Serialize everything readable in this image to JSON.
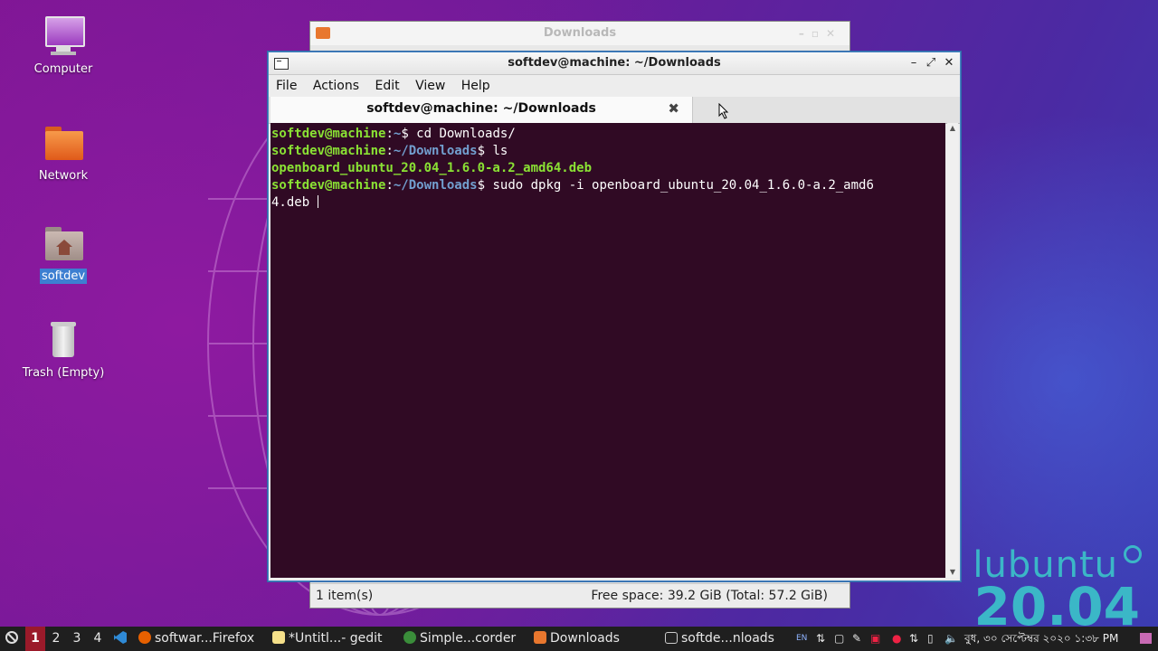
{
  "desktop": {
    "icons": [
      {
        "label": "Computer"
      },
      {
        "label": "Network"
      },
      {
        "label": "softdev"
      },
      {
        "label": "Trash (Empty)"
      }
    ]
  },
  "file_manager": {
    "title": "Downloads",
    "status_items": "1 item(s)",
    "status_free": "Free space: 39.2 GiB (Total: 57.2 GiB)"
  },
  "terminal": {
    "window_title": "softdev@machine: ~/Downloads",
    "menu": [
      "File",
      "Actions",
      "Edit",
      "View",
      "Help"
    ],
    "tab_title": "softdev@machine: ~/Downloads",
    "lines": [
      {
        "user": "softdev@machine",
        "path": "~",
        "prompt": "$",
        "cmd": " cd Downloads/"
      },
      {
        "user": "softdev@machine",
        "path": "~/Downloads",
        "prompt": "$",
        "cmd": " ls"
      },
      {
        "output": "openboard_ubuntu_20.04_1.6.0-a.2_amd64.deb"
      },
      {
        "user": "softdev@machine",
        "path": "~/Downloads",
        "prompt": "$",
        "cmd": " sudo dpkg -i openboard_ubuntu_20.04_1.6.0-a.2_amd6",
        "cont": "4.deb "
      }
    ]
  },
  "logo": {
    "name": "lubuntu",
    "version": "20.04"
  },
  "taskbar": {
    "workspaces": [
      "1",
      "2",
      "3",
      "4"
    ],
    "active_workspace": "1",
    "apps": [
      {
        "label": "softwar...Firefox",
        "icon": "firefox-icon",
        "color": "#e66000"
      },
      {
        "label": "*Untitl...- gedit",
        "icon": "gedit-icon",
        "color": "#f5e08a"
      },
      {
        "label": "Simple...corder",
        "icon": "recorder-icon",
        "color": "#3a8d3a"
      },
      {
        "label": "Downloads",
        "icon": "folder-icon",
        "color": "#e8772e"
      },
      {
        "label": "softde...nloads",
        "icon": "terminal-icon",
        "color": "#cccccc"
      }
    ],
    "keyboard_layout": "EN",
    "clock": "বুধ, ৩০ সেপ্টেম্বর ২০২০ ১:৩৮ PM"
  },
  "colors": {
    "prompt_user": "#8ae234",
    "prompt_path": "#729fcf",
    "terminal_bg": "#300a24",
    "accent_workspace": "#9b1a2a",
    "logo": "#3bb7c7"
  }
}
